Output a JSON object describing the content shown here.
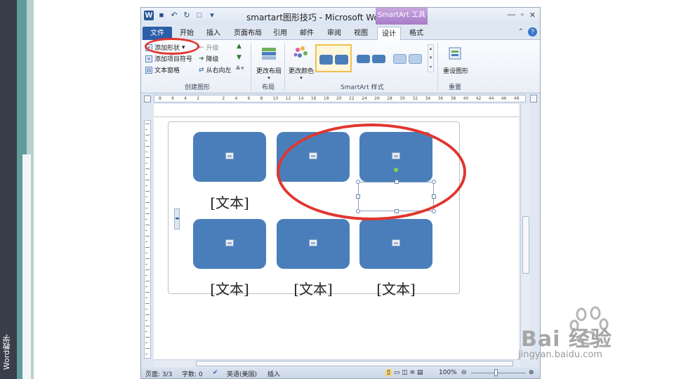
{
  "sidebar": {
    "caption": "Word教学"
  },
  "window": {
    "title": "smartart图形技巧 - Microsoft Word",
    "context_tab": "SmartArt 工具",
    "word_logo": "W"
  },
  "tabs": [
    {
      "label": "文件"
    },
    {
      "label": "开始"
    },
    {
      "label": "插入"
    },
    {
      "label": "页面布局"
    },
    {
      "label": "引用"
    },
    {
      "label": "邮件"
    },
    {
      "label": "审阅"
    },
    {
      "label": "视图"
    },
    {
      "label": "设计"
    },
    {
      "label": "格式"
    }
  ],
  "ribbon": {
    "create_group": {
      "add_shape": "添加形状",
      "add_bullet": "添加项目符号",
      "text_pane": "文本窗格",
      "promote": "升级",
      "demote": "降级",
      "right_to_left": "从右向左",
      "label": "创建图形"
    },
    "layout_group": {
      "change_layout": "更改布局",
      "label": "布局"
    },
    "styles_group": {
      "change_colors": "更改颜色",
      "label": "SmartArt 样式"
    },
    "reset_group": {
      "reset_graphic": "重设图形",
      "label": "重置"
    }
  },
  "ruler": {
    "ticks": [
      "8",
      "6",
      "4",
      "2",
      "",
      "2",
      "4",
      "6",
      "8",
      "10",
      "12",
      "14",
      "16",
      "18",
      "20",
      "22",
      "24",
      "26",
      "28",
      "30",
      "32",
      "34",
      "36",
      "38",
      "40",
      "42",
      "44",
      "46",
      "48"
    ]
  },
  "document": {
    "captions": [
      "[文本]",
      "[文本]",
      "[文本]",
      "[文本]"
    ]
  },
  "status": {
    "page": "页面: 3/3",
    "words": "字数: 0",
    "language": "英语(美国)",
    "mode": "插入",
    "zoom": "100%"
  },
  "watermark": {
    "brand": "Bai  经验",
    "url": "jingyan.baidu.com"
  },
  "colors": {
    "shape_fill": "#4a7ebb",
    "highlight_circle": "#e0362f",
    "file_tab": "#2b5da8"
  }
}
